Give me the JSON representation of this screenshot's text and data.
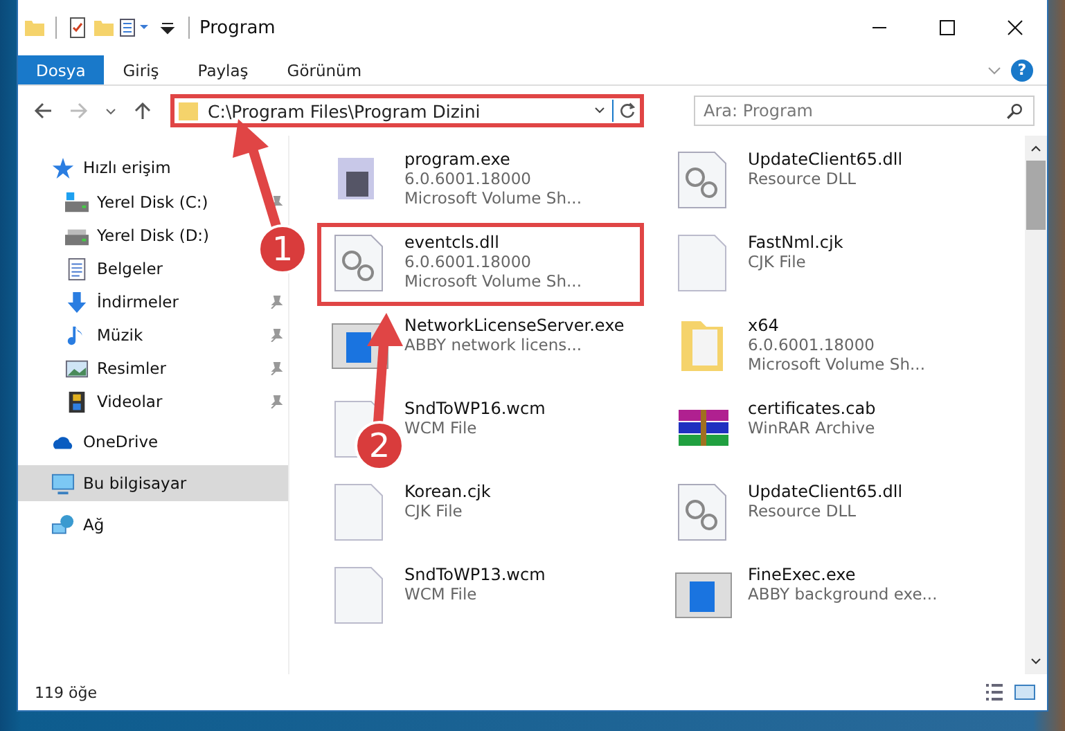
{
  "window": {
    "title": "Program"
  },
  "ribbon": {
    "tabs": [
      {
        "label": "Dosya",
        "selected": true
      },
      {
        "label": "Giriş",
        "selected": false
      },
      {
        "label": "Paylaş",
        "selected": false
      },
      {
        "label": "Görünüm",
        "selected": false
      }
    ],
    "help": "?"
  },
  "address_bar": {
    "path": "C:\\Program Files\\Program Dizini",
    "highlighted": true
  },
  "search": {
    "placeholder": "Ara: Program"
  },
  "sidebar": {
    "items": [
      {
        "label": "Hızlı erişim",
        "kind": "star",
        "pinned": false,
        "selected": false,
        "group": true
      },
      {
        "label": "Yerel Disk (C:)",
        "kind": "disk-c",
        "pinned": true,
        "selected": false,
        "group": false
      },
      {
        "label": "Yerel Disk (D:)",
        "kind": "disk",
        "pinned": false,
        "selected": false,
        "group": false
      },
      {
        "label": "Belgeler",
        "kind": "docs",
        "pinned": false,
        "selected": false,
        "group": false
      },
      {
        "label": "İndirmeler",
        "kind": "download",
        "pinned": true,
        "selected": false,
        "group": false
      },
      {
        "label": "Müzik",
        "kind": "music",
        "pinned": true,
        "selected": false,
        "group": false
      },
      {
        "label": "Resimler",
        "kind": "pictures",
        "pinned": true,
        "selected": false,
        "group": false
      },
      {
        "label": "Videolar",
        "kind": "videos",
        "pinned": true,
        "selected": false,
        "group": false
      },
      {
        "label": "OneDrive",
        "kind": "cloud",
        "pinned": false,
        "selected": false,
        "group": true
      },
      {
        "label": "Bu bilgisayar",
        "kind": "pc",
        "pinned": false,
        "selected": true,
        "group": true
      },
      {
        "label": "Ağ",
        "kind": "network",
        "pinned": false,
        "selected": false,
        "group": true
      }
    ]
  },
  "files": [
    {
      "name": "program.exe",
      "details": [
        "6.0.6001.18000",
        "Microsoft Volume Sh..."
      ],
      "kind": "exe",
      "highlighted": false
    },
    {
      "name": "UpdateClient65.dll",
      "details": [
        "Resource DLL"
      ],
      "kind": "dll",
      "highlighted": false
    },
    {
      "name": "eventcls.dll",
      "details": [
        "6.0.6001.18000",
        "Microsoft Volume Sh..."
      ],
      "kind": "dll",
      "highlighted": true
    },
    {
      "name": "FastNml.cjk",
      "details": [
        "CJK File"
      ],
      "kind": "file",
      "highlighted": false
    },
    {
      "name": "NetworkLicenseServer.exe",
      "details": [
        "ABBY network licens..."
      ],
      "kind": "app",
      "highlighted": false
    },
    {
      "name": "x64",
      "details": [
        "6.0.6001.18000",
        "Microsoft Volume Sh..."
      ],
      "kind": "folder",
      "highlighted": false
    },
    {
      "name": "SndToWP16.wcm",
      "details": [
        "WCM File"
      ],
      "kind": "file",
      "highlighted": false
    },
    {
      "name": "certificates.cab",
      "details": [
        "WinRAR Archive"
      ],
      "kind": "archive",
      "highlighted": false
    },
    {
      "name": "Korean.cjk",
      "details": [
        "CJK File"
      ],
      "kind": "file",
      "highlighted": false
    },
    {
      "name": "UpdateClient65.dll",
      "details": [
        "Resource DLL"
      ],
      "kind": "dll",
      "highlighted": false
    },
    {
      "name": "SndToWP13.wcm",
      "details": [
        "WCM File"
      ],
      "kind": "file",
      "highlighted": false
    },
    {
      "name": "FineExec.exe",
      "details": [
        "ABBY background exe..."
      ],
      "kind": "app",
      "highlighted": false
    }
  ],
  "status_bar": {
    "count": "119 öğe"
  },
  "annotations": [
    {
      "number": "1"
    },
    {
      "number": "2"
    }
  ]
}
